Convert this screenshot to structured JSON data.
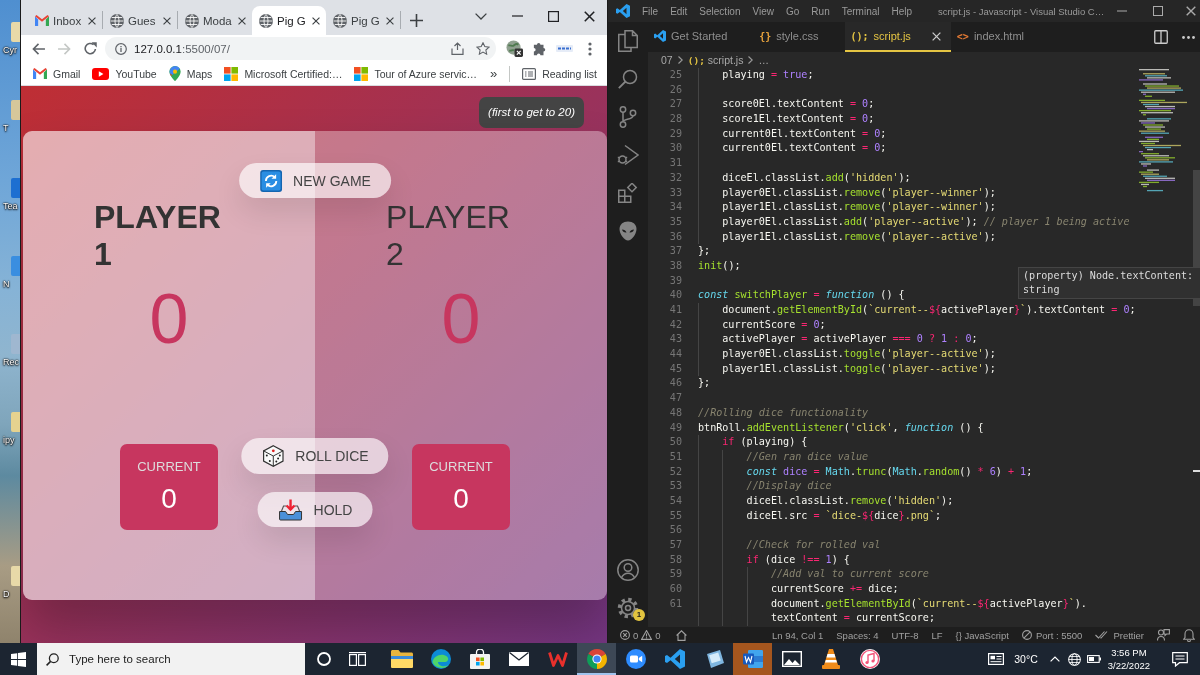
{
  "desktop": {
    "icons": [
      {
        "label": "Cyr"
      },
      {
        "label": "T"
      },
      {
        "label": "Tea"
      },
      {
        "label": "N"
      },
      {
        "label": "Rec"
      },
      {
        "label": "ipy"
      },
      {
        "label": "D"
      }
    ]
  },
  "chrome": {
    "tabs": [
      {
        "title": "Inbox",
        "selected": false
      },
      {
        "title": "Gues",
        "selected": false
      },
      {
        "title": "Moda",
        "selected": false
      },
      {
        "title": "Pig G",
        "selected": true
      },
      {
        "title": "Pig G",
        "selected": false
      }
    ],
    "toolbar": {
      "forward_disabled": true,
      "url_host": "127.0.0.1",
      "url_path": ":5500/07/"
    },
    "bookmarks": [
      {
        "label": "Gmail"
      },
      {
        "label": "YouTube"
      },
      {
        "label": "Maps"
      },
      {
        "label": "Microsoft Certified:…"
      },
      {
        "label": "Tour of Azure servic…"
      }
    ],
    "more_bookmarks": "»",
    "reading_list": "Reading list"
  },
  "game": {
    "goal_note": "(first to get to 20)",
    "new_game": "NEW GAME",
    "players": [
      {
        "name": "PLAYER 1",
        "active": true,
        "score": "0",
        "current_label": "CURRENT",
        "current": "0"
      },
      {
        "name": "PLAYER 2",
        "active": false,
        "score": "0",
        "current_label": "CURRENT",
        "current": "0"
      }
    ],
    "roll_dice": "ROLL DICE",
    "hold": "HOLD"
  },
  "vscode": {
    "menu": [
      "File",
      "Edit",
      "Selection",
      "View",
      "Go",
      "Run",
      "Terminal",
      "Help"
    ],
    "title": "script.js - Javascript - Visual Studio C…",
    "tabs": [
      {
        "kind": "welcome",
        "label": "Get Started",
        "selected": false
      },
      {
        "kind": "file",
        "glyph": "{}",
        "color": "#e8a33d",
        "label": "style.css",
        "selected": false
      },
      {
        "kind": "file",
        "glyph": "();",
        "color": "#e5c543",
        "label": "script.js",
        "selected": true
      },
      {
        "kind": "file",
        "glyph": "<>",
        "color": "#e37933",
        "label": "index.html",
        "selected": false
      }
    ],
    "breadcrumb": [
      {
        "label": "07"
      },
      {
        "glyph": "();",
        "label": "script.js"
      },
      {
        "label": "…"
      }
    ],
    "lines": [
      {
        "number": "25",
        "tokens": [
          {
            "kind": "plain",
            "text": "    playing "
          },
          {
            "kind": "op",
            "text": "="
          },
          {
            "kind": "num",
            "text": " true"
          },
          {
            "kind": "plain",
            "text": ";"
          }
        ]
      },
      {
        "number": "26"
      },
      {
        "number": "27",
        "tokens": [
          {
            "kind": "plain",
            "text": "    score0El.textContent "
          },
          {
            "kind": "op",
            "text": "="
          },
          {
            "kind": "num",
            "text": " 0"
          },
          {
            "kind": "plain",
            "text": ";"
          }
        ]
      },
      {
        "number": "28",
        "tokens": [
          {
            "kind": "plain",
            "text": "    score1El.textContent "
          },
          {
            "kind": "op",
            "text": "="
          },
          {
            "kind": "num",
            "text": " 0"
          },
          {
            "kind": "plain",
            "text": ";"
          }
        ]
      },
      {
        "number": "29",
        "tokens": [
          {
            "kind": "plain",
            "text": "    current0El.textContent "
          },
          {
            "kind": "op",
            "text": "="
          },
          {
            "kind": "num",
            "text": " 0"
          },
          {
            "kind": "plain",
            "text": ";"
          }
        ]
      },
      {
        "number": "30",
        "tokens": [
          {
            "kind": "plain",
            "text": "    current0El.textContent "
          },
          {
            "kind": "op",
            "text": "="
          },
          {
            "kind": "num",
            "text": " 0"
          },
          {
            "kind": "plain",
            "text": ";"
          }
        ]
      },
      {
        "number": "31"
      },
      {
        "number": "32",
        "tokens": [
          {
            "kind": "plain",
            "text": "    diceEl.classList."
          },
          {
            "kind": "fn",
            "text": "add"
          },
          {
            "kind": "plain",
            "text": "("
          },
          {
            "kind": "str",
            "text": "'hidden'"
          },
          {
            "kind": "plain",
            "text": ");"
          }
        ]
      },
      {
        "number": "33",
        "tokens": [
          {
            "kind": "plain",
            "text": "    player0El.classList."
          },
          {
            "kind": "fn",
            "text": "remove"
          },
          {
            "kind": "plain",
            "text": "("
          },
          {
            "kind": "str",
            "text": "'player--winner'"
          },
          {
            "kind": "plain",
            "text": ");"
          }
        ]
      },
      {
        "number": "34",
        "tokens": [
          {
            "kind": "plain",
            "text": "    player1El.classList."
          },
          {
            "kind": "fn",
            "text": "remove"
          },
          {
            "kind": "plain",
            "text": "("
          },
          {
            "kind": "str",
            "text": "'player--winner'"
          },
          {
            "kind": "plain",
            "text": ");"
          }
        ]
      },
      {
        "number": "35",
        "tokens": [
          {
            "kind": "plain",
            "text": "    player0El.classList."
          },
          {
            "kind": "fn",
            "text": "add"
          },
          {
            "kind": "plain",
            "text": "("
          },
          {
            "kind": "str",
            "text": "'player--active'"
          },
          {
            "kind": "plain",
            "text": "); "
          },
          {
            "kind": "comment",
            "text": "// player 1 being active"
          }
        ]
      },
      {
        "number": "36",
        "tokens": [
          {
            "kind": "plain",
            "text": "    player1El.classList."
          },
          {
            "kind": "fn",
            "text": "remove"
          },
          {
            "kind": "plain",
            "text": "("
          },
          {
            "kind": "str",
            "text": "'player--active'"
          },
          {
            "kind": "plain",
            "text": ");"
          }
        ]
      },
      {
        "number": "37",
        "tokens": [
          {
            "kind": "plain",
            "text": "};"
          }
        ]
      },
      {
        "number": "38",
        "tokens": [
          {
            "kind": "fn",
            "text": "init"
          },
          {
            "kind": "plain",
            "text": "();"
          }
        ]
      },
      {
        "number": "39"
      },
      {
        "number": "40",
        "tokens": [
          {
            "kind": "keyword",
            "text": "const"
          },
          {
            "kind": "fn",
            "text": " switchPlayer "
          },
          {
            "kind": "op",
            "text": "="
          },
          {
            "kind": "keyword",
            "text": " function"
          },
          {
            "kind": "plain",
            "text": " () {"
          }
        ]
      },
      {
        "number": "41",
        "tokens": [
          {
            "kind": "plain",
            "text": "    document."
          },
          {
            "kind": "fn",
            "text": "getElementById"
          },
          {
            "kind": "plain",
            "text": "("
          },
          {
            "kind": "str",
            "text": "`current--"
          },
          {
            "kind": "op",
            "text": "${"
          },
          {
            "kind": "plain",
            "text": "activePlayer"
          },
          {
            "kind": "op",
            "text": "}"
          },
          {
            "kind": "str",
            "text": "`"
          },
          {
            "kind": "plain",
            "text": ").textContent "
          },
          {
            "kind": "op",
            "text": "="
          },
          {
            "kind": "num",
            "text": " 0"
          },
          {
            "kind": "plain",
            "text": ";"
          }
        ]
      },
      {
        "number": "42",
        "tokens": [
          {
            "kind": "plain",
            "text": "    currentScore "
          },
          {
            "kind": "op",
            "text": "="
          },
          {
            "kind": "num",
            "text": " 0"
          },
          {
            "kind": "plain",
            "text": ";"
          }
        ]
      },
      {
        "number": "43",
        "tokens": [
          {
            "kind": "plain",
            "text": "    activePlayer "
          },
          {
            "kind": "op",
            "text": "="
          },
          {
            "kind": "plain",
            "text": " activePlayer "
          },
          {
            "kind": "op",
            "text": "==="
          },
          {
            "kind": "num",
            "text": " 0 "
          },
          {
            "kind": "op",
            "text": "?"
          },
          {
            "kind": "num",
            "text": " 1 "
          },
          {
            "kind": "op",
            "text": ":"
          },
          {
            "kind": "num",
            "text": " 0"
          },
          {
            "kind": "plain",
            "text": ";"
          }
        ]
      },
      {
        "number": "44",
        "tokens": [
          {
            "kind": "plain",
            "text": "    player0El.classList."
          },
          {
            "kind": "fn",
            "text": "toggle"
          },
          {
            "kind": "plain",
            "text": "("
          },
          {
            "kind": "str",
            "text": "'player--active'"
          },
          {
            "kind": "plain",
            "text": ");"
          }
        ]
      },
      {
        "number": "45",
        "tokens": [
          {
            "kind": "plain",
            "text": "    player1El.classList."
          },
          {
            "kind": "fn",
            "text": "toggle"
          },
          {
            "kind": "plain",
            "text": "("
          },
          {
            "kind": "str",
            "text": "'player--active'"
          },
          {
            "kind": "plain",
            "text": ");"
          }
        ]
      },
      {
        "number": "46",
        "tokens": [
          {
            "kind": "plain",
            "text": "};"
          }
        ]
      },
      {
        "number": "47"
      },
      {
        "number": "48",
        "tokens": [
          {
            "kind": "comment",
            "text": "//Rolling dice functionality"
          }
        ]
      },
      {
        "number": "49",
        "tokens": [
          {
            "kind": "plain",
            "text": "btnRoll."
          },
          {
            "kind": "fn",
            "text": "addEventListener"
          },
          {
            "kind": "plain",
            "text": "("
          },
          {
            "kind": "str",
            "text": "'click'"
          },
          {
            "kind": "plain",
            "text": ", "
          },
          {
            "kind": "keyword",
            "text": "function"
          },
          {
            "kind": "plain",
            "text": " () {"
          }
        ]
      },
      {
        "number": "50",
        "tokens": [
          {
            "kind": "op",
            "text": "    if"
          },
          {
            "kind": "plain",
            "text": " (playing) {"
          }
        ]
      },
      {
        "number": "51",
        "tokens": [
          {
            "kind": "comment",
            "text": "        //Gen ran dice value"
          }
        ]
      },
      {
        "number": "52",
        "tokens": [
          {
            "kind": "keyword",
            "text": "        const"
          },
          {
            "kind": "num",
            "text": " dice "
          },
          {
            "kind": "op",
            "text": "="
          },
          {
            "kind": "support",
            "text": " Math"
          },
          {
            "kind": "plain",
            "text": "."
          },
          {
            "kind": "fn",
            "text": "trunc"
          },
          {
            "kind": "plain",
            "text": "("
          },
          {
            "kind": "support",
            "text": "Math"
          },
          {
            "kind": "plain",
            "text": "."
          },
          {
            "kind": "fn",
            "text": "random"
          },
          {
            "kind": "plain",
            "text": "() "
          },
          {
            "kind": "op",
            "text": "*"
          },
          {
            "kind": "num",
            "text": " 6"
          },
          {
            "kind": "plain",
            "text": ") "
          },
          {
            "kind": "op",
            "text": "+"
          },
          {
            "kind": "num",
            "text": " 1"
          },
          {
            "kind": "plain",
            "text": ";"
          }
        ]
      },
      {
        "number": "53",
        "tokens": [
          {
            "kind": "comment",
            "text": "        //Display dice"
          }
        ]
      },
      {
        "number": "54",
        "tokens": [
          {
            "kind": "plain",
            "text": "        diceEl.classList."
          },
          {
            "kind": "fn",
            "text": "remove"
          },
          {
            "kind": "plain",
            "text": "("
          },
          {
            "kind": "str",
            "text": "'hidden'"
          },
          {
            "kind": "plain",
            "text": ");"
          }
        ]
      },
      {
        "number": "55",
        "tokens": [
          {
            "kind": "plain",
            "text": "        diceEl.src "
          },
          {
            "kind": "op",
            "text": "="
          },
          {
            "kind": "str",
            "text": " `dice-"
          },
          {
            "kind": "op",
            "text": "${"
          },
          {
            "kind": "plain",
            "text": "dice"
          },
          {
            "kind": "op",
            "text": "}"
          },
          {
            "kind": "str",
            "text": ".png`"
          },
          {
            "kind": "plain",
            "text": ";"
          }
        ]
      },
      {
        "number": "56"
      },
      {
        "number": "57",
        "tokens": [
          {
            "kind": "comment",
            "text": "        //Check for rolled val"
          }
        ]
      },
      {
        "number": "58",
        "tokens": [
          {
            "kind": "op",
            "text": "        if"
          },
          {
            "kind": "plain",
            "text": " (dice "
          },
          {
            "kind": "op",
            "text": "!=="
          },
          {
            "kind": "num",
            "text": " 1"
          },
          {
            "kind": "plain",
            "text": ") {"
          }
        ]
      },
      {
        "number": "59",
        "tokens": [
          {
            "kind": "comment",
            "text": "            //Add val to current score"
          }
        ]
      },
      {
        "number": "60",
        "tokens": [
          {
            "kind": "plain",
            "text": "            currentScore "
          },
          {
            "kind": "op",
            "text": "+="
          },
          {
            "kind": "plain",
            "text": " dice;"
          }
        ]
      },
      {
        "number": "61",
        "tokens": [
          {
            "kind": "plain",
            "text": "            document."
          },
          {
            "kind": "fn",
            "text": "getElementById"
          },
          {
            "kind": "plain",
            "text": "("
          },
          {
            "kind": "str",
            "text": "`current--"
          },
          {
            "kind": "op",
            "text": "${"
          },
          {
            "kind": "plain",
            "text": "activePlayer"
          },
          {
            "kind": "op",
            "text": "}"
          },
          {
            "kind": "str",
            "text": "`"
          },
          {
            "kind": "plain",
            "text": ")."
          }
        ]
      },
      {
        "tokens": [
          {
            "kind": "plain",
            "text": "            textContent "
          },
          {
            "kind": "op",
            "text": "="
          },
          {
            "kind": "plain",
            "text": " currentScore;"
          }
        ]
      }
    ],
    "hover": "(property) Node.textContent: string",
    "settings_badge": "1",
    "status": {
      "errors": "0",
      "warnings": "0",
      "items": [
        "Ln 94, Col 1",
        "Spaces: 4",
        "UTF-8",
        "LF",
        "{} JavaScript"
      ],
      "port": "Port : 5500",
      "prettier": "Prettier"
    }
  },
  "taskbar": {
    "search_placeholder": "Type here to search",
    "apps": [
      {
        "selected": false,
        "flashing": false
      },
      {
        "selected": false,
        "flashing": false
      },
      {
        "selected": false,
        "flashing": false
      },
      {
        "selected": false,
        "flashing": false
      },
      {
        "selected": false,
        "flashing": false
      },
      {
        "selected": true,
        "flashing": false
      },
      {
        "selected": false,
        "flashing": false
      },
      {
        "selected": false,
        "flashing": false
      },
      {
        "selected": false,
        "flashing": false
      },
      {
        "selected": false,
        "flashing": true
      },
      {
        "selected": false,
        "flashing": false
      },
      {
        "selected": false,
        "flashing": false
      },
      {
        "selected": false,
        "flashing": false
      }
    ],
    "temperature": "30°C",
    "time": "3:56 PM",
    "date": "3/22/2022"
  }
}
